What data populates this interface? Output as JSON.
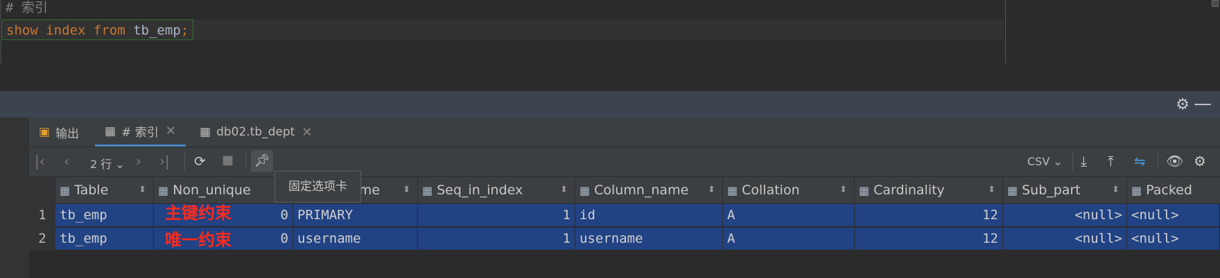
{
  "editor": {
    "comment": "# 索引",
    "code": {
      "kw1": "show",
      "kw2": "index",
      "kw3": "from",
      "table": "tb_emp",
      "semi": ";"
    }
  },
  "panel": {
    "settings_icon": "gear-icon",
    "minimize_icon": "minus-icon"
  },
  "tabs": [
    {
      "label": "输出",
      "icon": "output-icon"
    },
    {
      "label": "# 索引",
      "icon": "table-icon",
      "active": true
    },
    {
      "label": "db02.tb_dept",
      "icon": "table-icon"
    }
  ],
  "toolbar": {
    "rows": "2 行",
    "format": "CSV",
    "tooltip": "固定选项卡"
  },
  "grid": {
    "columns": [
      "Table",
      "Non_unique",
      "Key_name",
      "Seq_in_index",
      "Column_name",
      "Collation",
      "Cardinality",
      "Sub_part",
      "Packed"
    ],
    "rows": [
      {
        "num": "1",
        "Table": "tb_emp",
        "Non_unique": "0",
        "Key_name": "PRIMARY",
        "Seq_in_index": "1",
        "Column_name": "id",
        "Collation": "A",
        "Cardinality": "12",
        "Sub_part": "<null>",
        "Packed": "<null>"
      },
      {
        "num": "2",
        "Table": "tb_emp",
        "Non_unique": "0",
        "Key_name": "username",
        "Seq_in_index": "1",
        "Column_name": "username",
        "Collation": "A",
        "Cardinality": "12",
        "Sub_part": "<null>",
        "Packed": "<null>"
      }
    ]
  },
  "annotations": [
    "主键约束",
    "唯一约束"
  ],
  "colors": {
    "selection": "#214283",
    "annotation": "#ff2a1a",
    "keyword": "#cc7832"
  }
}
